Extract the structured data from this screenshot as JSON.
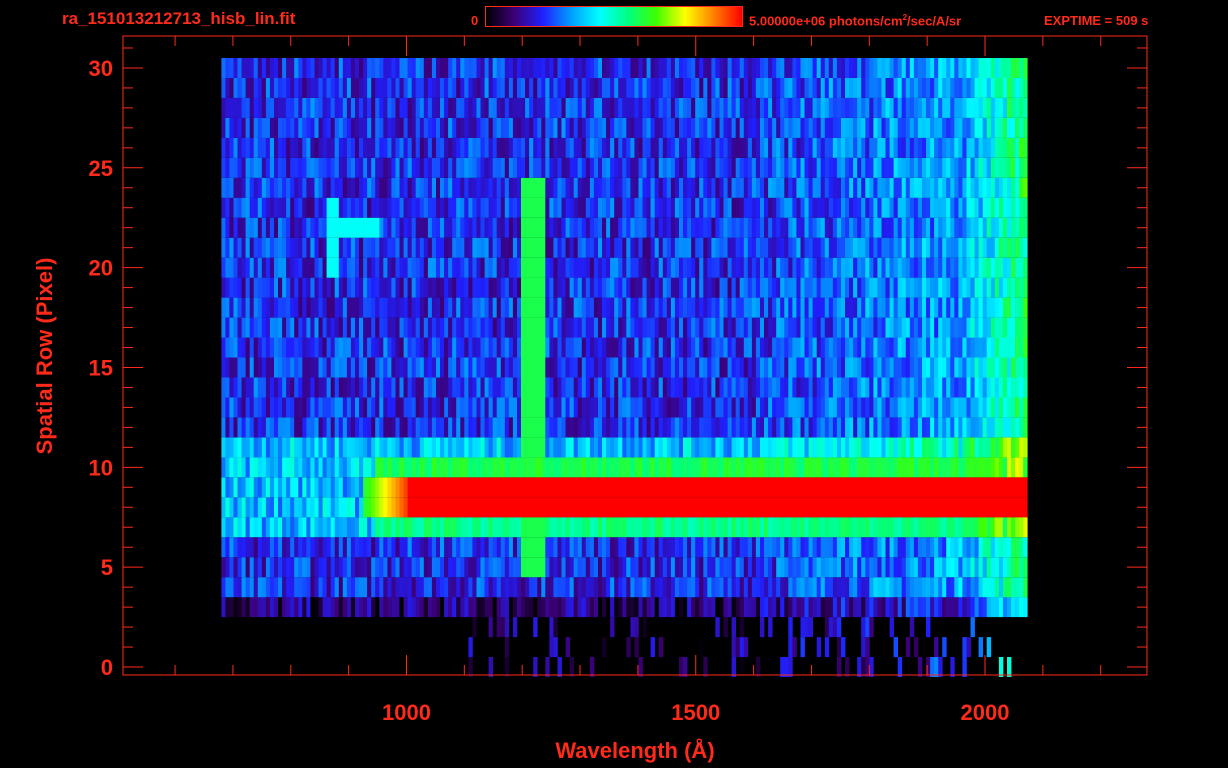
{
  "header": {
    "file_title": "ra_151013212713_hisb_lin.fit",
    "colorbar_min": "0",
    "colorbar_max_prefix": "5.00000e+06 photons/cm",
    "colorbar_max_sup": "2",
    "colorbar_max_suffix": "/sec/A/sr",
    "exptime": "EXPTIME = 509 s"
  },
  "colors": {
    "annotation": "#ff2a1a",
    "colormap": [
      "#000000",
      "#3c0078",
      "#2020ff",
      "#00a0ff",
      "#00ffff",
      "#00ff80",
      "#40ff00",
      "#ffff00",
      "#ff8000",
      "#ff0000"
    ]
  },
  "chart_data": {
    "type": "heatmap",
    "xlabel": "Wavelength (Å)",
    "ylabel": "Spatial Row (Pixel)",
    "xlim": [
      510,
      2280
    ],
    "ylim": [
      -0.4,
      31.6
    ],
    "x_ticks": [
      1000,
      1500,
      2000
    ],
    "y_ticks": [
      0,
      5,
      10,
      15,
      20,
      25,
      30
    ],
    "colorbar_range": [
      0,
      5000000
    ],
    "colorbar_units": "photons/cm^2/sec/A/sr",
    "detector_extent": {
      "wavelength": [
        680,
        2070
      ],
      "rows": [
        0,
        30
      ]
    },
    "features": [
      {
        "kind": "bright band",
        "rows": [
          8,
          10
        ],
        "wavelength": [
          920,
          2070
        ],
        "level": "saturated"
      },
      {
        "kind": "emission line",
        "wavelength": 1216,
        "rows": [
          5,
          24
        ]
      },
      {
        "kind": "arc feature",
        "wavelength": [
          860,
          950
        ],
        "rows": [
          20,
          23
        ]
      }
    ]
  }
}
